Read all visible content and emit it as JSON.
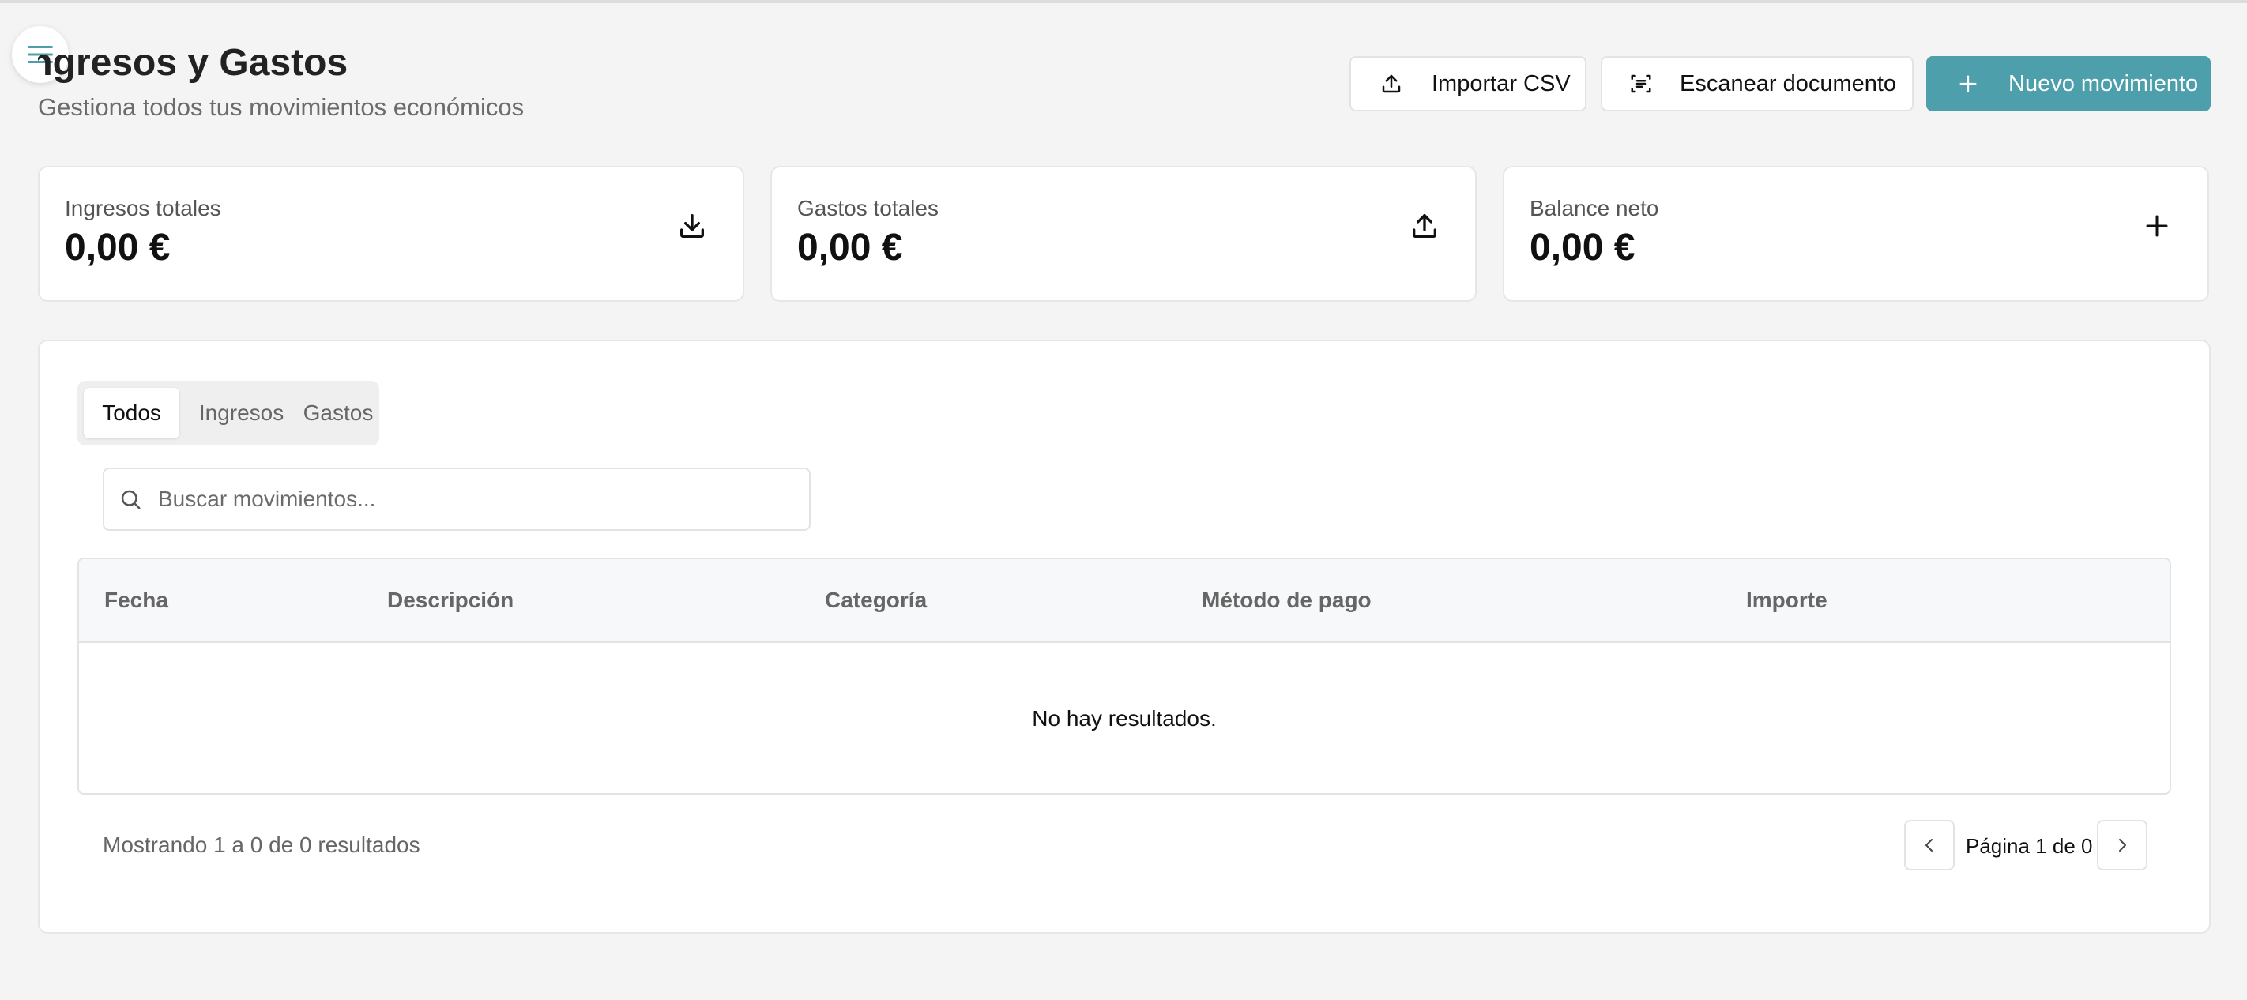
{
  "header": {
    "title": "Ingresos y Gastos",
    "subtitle": "Gestiona todos tus movimientos económicos"
  },
  "icons": {
    "menu": "menu-icon",
    "import": "upload-icon",
    "scan": "scan-icon",
    "new": "plus-icon",
    "income": "download-icon",
    "expenses": "upload-icon",
    "balance": "plus-icon",
    "search": "search-icon",
    "prev": "chevron-left-icon",
    "next": "chevron-right-icon"
  },
  "colors": {
    "accent": "#4e9fac",
    "background": "#f4f4f4",
    "card": "#ffffff"
  },
  "actions": {
    "import_label": "Importar CSV",
    "scan_label": "Escanear documento",
    "new_label": "Nuevo movimiento"
  },
  "stats": [
    {
      "label": "Ingresos totales",
      "value": "0,00 €"
    },
    {
      "label": "Gastos totales",
      "value": "0,00 €"
    },
    {
      "label": "Balance neto",
      "value": "0,00 €"
    }
  ],
  "tabs": [
    {
      "label": "Todos",
      "active": true
    },
    {
      "label": "Ingresos",
      "active": false
    },
    {
      "label": "Gastos",
      "active": false
    }
  ],
  "search": {
    "placeholder": "Buscar movimientos...",
    "value": ""
  },
  "table": {
    "columns": [
      "Fecha",
      "Descripción",
      "Categoría",
      "Método de pago",
      "Importe"
    ],
    "rows": [],
    "empty_message": "No hay resultados."
  },
  "pagination": {
    "summary": "Mostrando 1 a 0 de 0 resultados",
    "page_label": "Página 1 de 0"
  }
}
